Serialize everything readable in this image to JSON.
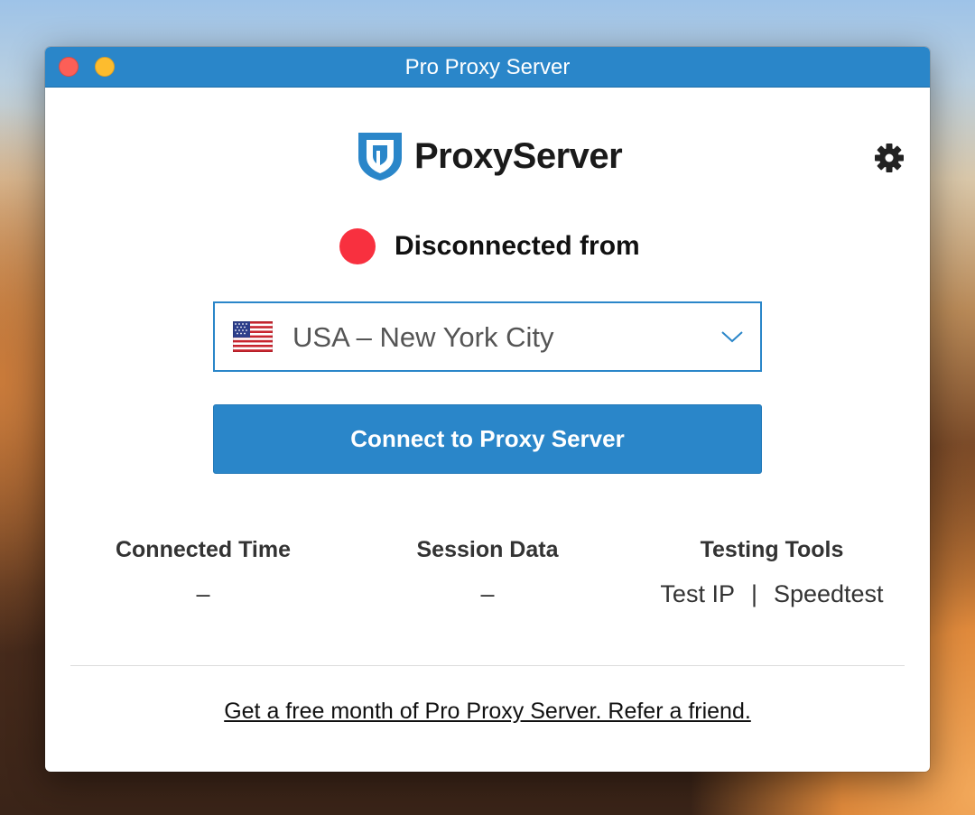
{
  "window": {
    "title": "Pro Proxy Server"
  },
  "brand": {
    "name": "ProxyServer",
    "accent_color": "#2a86c9"
  },
  "status": {
    "text": "Disconnected from",
    "indicator_color": "#f8303f"
  },
  "location": {
    "selected": "USA – New York City",
    "flag": "us-flag-icon"
  },
  "actions": {
    "connect_label": "Connect to Proxy Server"
  },
  "stats": {
    "connected_time": {
      "label": "Connected Time",
      "value": "–"
    },
    "session_data": {
      "label": "Session Data",
      "value": "–"
    },
    "testing_tools": {
      "label": "Testing Tools",
      "test_ip": "Test IP",
      "separator": "|",
      "speedtest": "Speedtest"
    }
  },
  "footer": {
    "referral_text": "Get a free month of Pro Proxy Server. Refer a friend."
  }
}
